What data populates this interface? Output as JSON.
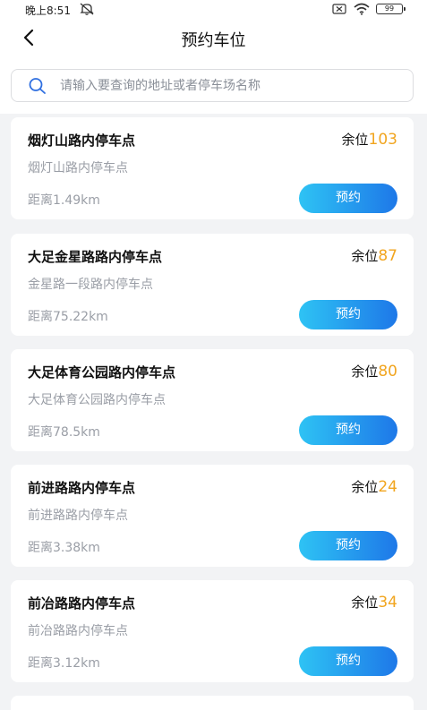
{
  "status_bar": {
    "time": "晚上8:51",
    "battery": "99"
  },
  "header": {
    "title": "预约车位",
    "back_icon": "chevron-left-icon"
  },
  "search": {
    "placeholder": "请输入要查询的地址或者停车场名称",
    "icon": "search-icon"
  },
  "lots": [
    {
      "name": "烟灯山路内停车点",
      "address": "烟灯山路内停车点",
      "spare_label": "余位",
      "spare_count": "103",
      "distance": "距离1.49km",
      "button_label": "预约"
    },
    {
      "name": "大足金星路路内停车点",
      "address": "金星路一段路内停车点",
      "spare_label": "余位",
      "spare_count": "87",
      "distance": "距离75.22km",
      "button_label": "预约"
    },
    {
      "name": "大足体育公园路内停车点",
      "address": "大足体育公园路内停车点",
      "spare_label": "余位",
      "spare_count": "80",
      "distance": "距离78.5km",
      "button_label": "预约"
    },
    {
      "name": "前进路路内停车点",
      "address": "前进路路内停车点",
      "spare_label": "余位",
      "spare_count": "24",
      "distance": "距离3.38km",
      "button_label": "预约"
    },
    {
      "name": "前冶路路内停车点",
      "address": "前冶路路内停车点",
      "spare_label": "余位",
      "spare_count": "34",
      "distance": "距离3.12km",
      "button_label": "预约"
    }
  ],
  "colors": {
    "accent_start": "#2ec3f4",
    "accent_end": "#1e78e8",
    "spare_count": "#f1a51f",
    "background": "#f2f3f5"
  }
}
